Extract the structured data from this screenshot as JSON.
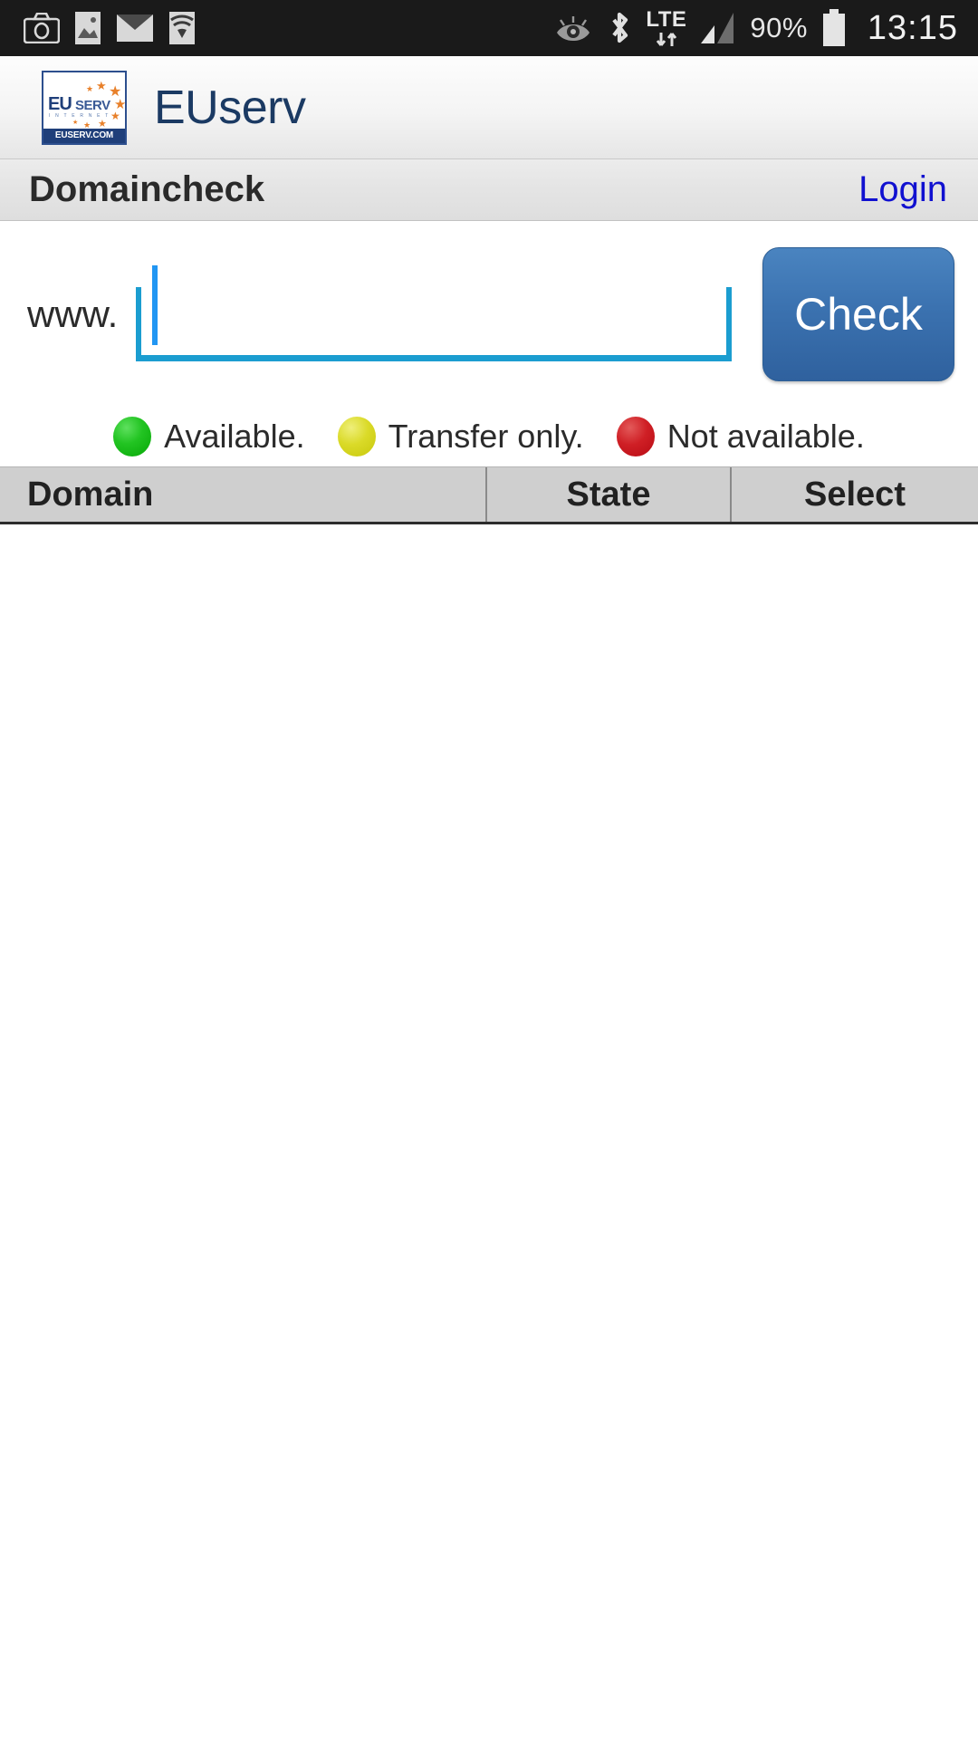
{
  "status_bar": {
    "left_icons": [
      "camera-icon",
      "gallery-icon",
      "mail-icon",
      "wifi-icon"
    ],
    "right_icons": [
      "eye-icon",
      "bluetooth-icon",
      "lte-icon",
      "signal-icon"
    ],
    "network_label": "LTE",
    "battery_percent": "90%",
    "clock": "13:15"
  },
  "app_header": {
    "brand": "EUserv",
    "logo": {
      "eu": "EU",
      "serv": "SERV",
      "internet": "I N T E R N E T",
      "domain": "EUSERV.COM"
    }
  },
  "page": {
    "title": "Domaincheck",
    "login_label": "Login"
  },
  "search": {
    "prefix_label": "www.",
    "input_value": "",
    "placeholder": "",
    "check_label": "Check"
  },
  "legend": [
    {
      "status": "available",
      "label": "Available.",
      "color": "#22c422"
    },
    {
      "status": "transfer-only",
      "label": "Transfer only.",
      "color": "#dada28"
    },
    {
      "status": "not-available",
      "label": "Not available.",
      "color": "#cf1f25"
    }
  ],
  "results_table": {
    "columns": [
      "Domain",
      "State",
      "Select"
    ],
    "rows": []
  },
  "colors": {
    "accent_blue": "#1b9dd0",
    "button_blue": "#3b72b0",
    "link_blue": "#1010d0",
    "brand_navy": "#1b3a63",
    "statusbar_bg": "#1a1a1a",
    "table_header_bg": "#cfcfcf"
  }
}
